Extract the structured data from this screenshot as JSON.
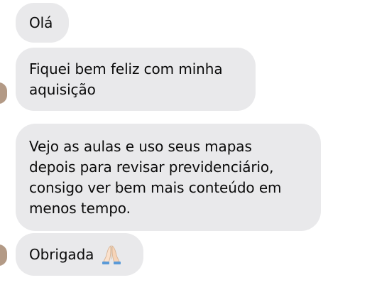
{
  "messages": [
    {
      "text": "Olá"
    },
    {
      "text": "Fiquei bem feliz com minha\naquisição"
    },
    {
      "text": "Vejo as aulas e uso seus mapas\ndepois para revisar previdenciário,\nconsigo ver bem mais conteúdo em\nmenos tempo."
    },
    {
      "text": "Obrigada",
      "emoji": "folded-hands-icon"
    }
  ],
  "colors": {
    "bubble_background": "#e9e9eb",
    "text": "#0a0a0a",
    "avatar": "#b39a86"
  }
}
